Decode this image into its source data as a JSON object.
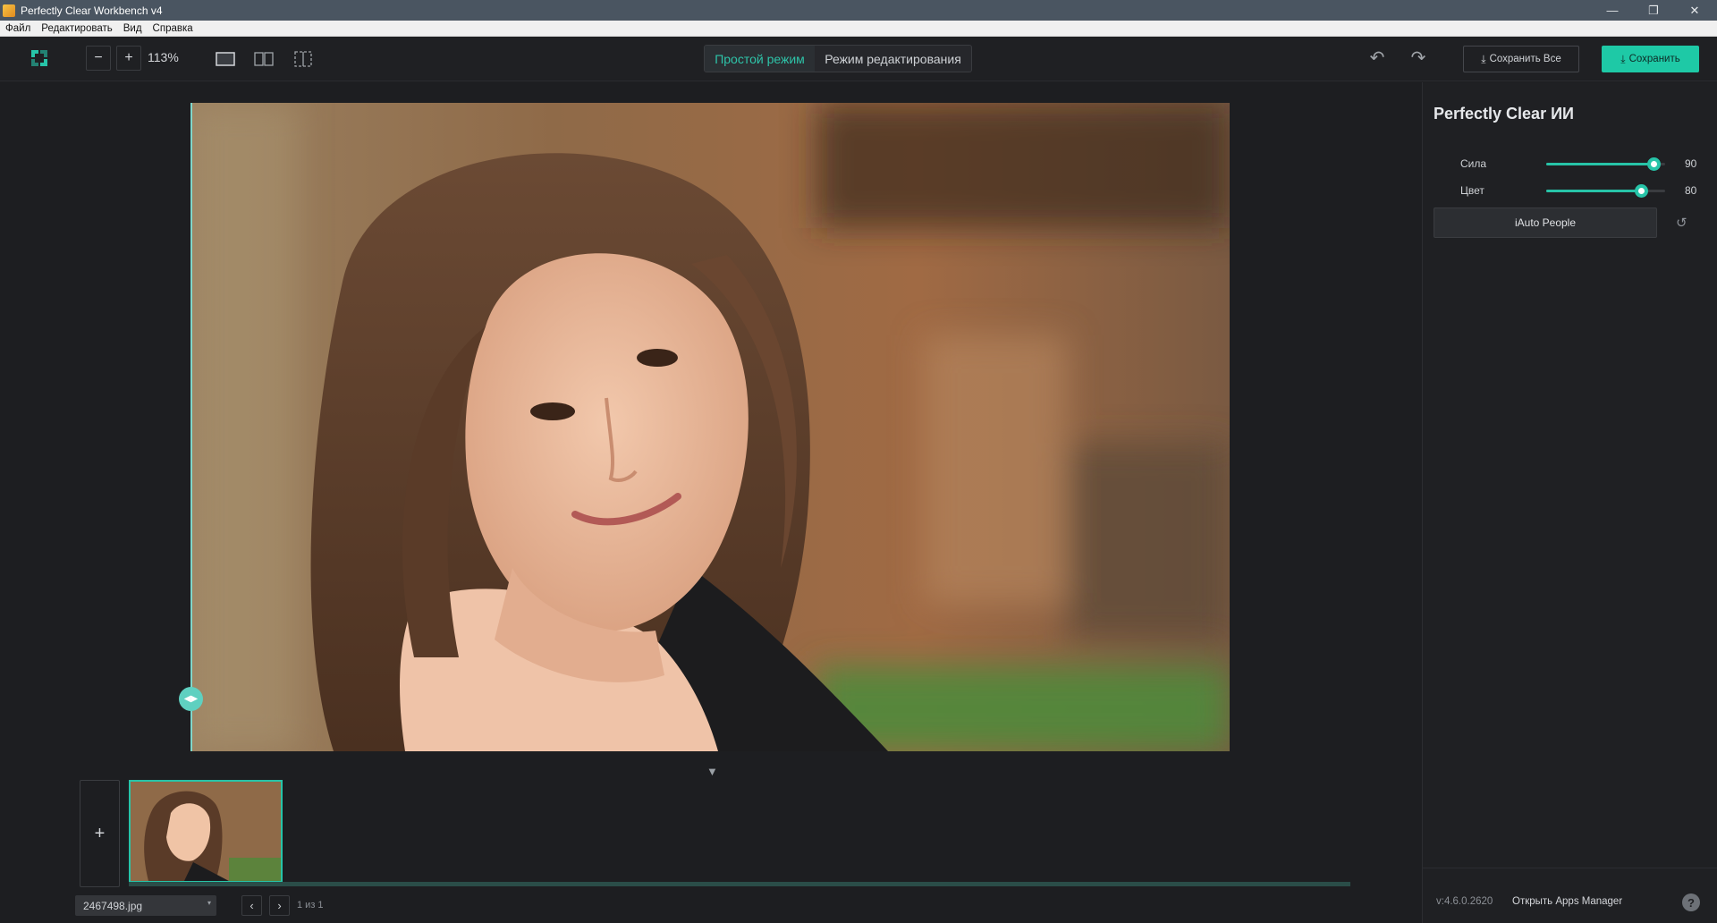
{
  "window": {
    "title": "Perfectly Clear Workbench v4",
    "controls": {
      "minimize": "—",
      "maximize": "❐",
      "close": "✕"
    }
  },
  "menu": [
    "Файл",
    "Редактировать",
    "Вид",
    "Справка"
  ],
  "toolbar": {
    "zoom_out": "−",
    "zoom_in": "+",
    "zoom_value": "113%",
    "modes": {
      "simple": "Простой режим",
      "edit": "Режим редактирования",
      "active": "simple"
    },
    "save_all_label": "Сохранить Все",
    "save_label": "Сохранить",
    "undo_icon": "↶",
    "redo_icon": "↷",
    "icons": [
      "app-logo-icon",
      "single-view-icon",
      "split-view-icon",
      "crop-view-icon",
      "download-icon"
    ]
  },
  "canvas": {
    "compare_handle": "◀▶",
    "collapse_arrow": "▼",
    "photo_subject": "portrait of a smiling woman with long brown hair"
  },
  "filmstrip": {
    "add_label": "+",
    "file_name": "2467498.jpg",
    "file_select_arrow": "▾",
    "prev": "‹",
    "next": "›",
    "page_count": "1 из 1"
  },
  "panel": {
    "title": "Perfectly Clear ИИ",
    "sliders": [
      {
        "label": "Сила",
        "value": 90,
        "max": 100
      },
      {
        "label": "Цвет",
        "value": 80,
        "max": 100
      }
    ],
    "preset_button": "iAuto People",
    "reset_icon": "↺"
  },
  "footer": {
    "version": "v:4.6.0.2620",
    "apps_manager": "Открыть Apps Manager",
    "help": "?"
  },
  "colors": {
    "accent": "#1ec9a6",
    "titlebar": "#4a5561",
    "background": "#1e1f22",
    "panel": "#1f2023"
  }
}
